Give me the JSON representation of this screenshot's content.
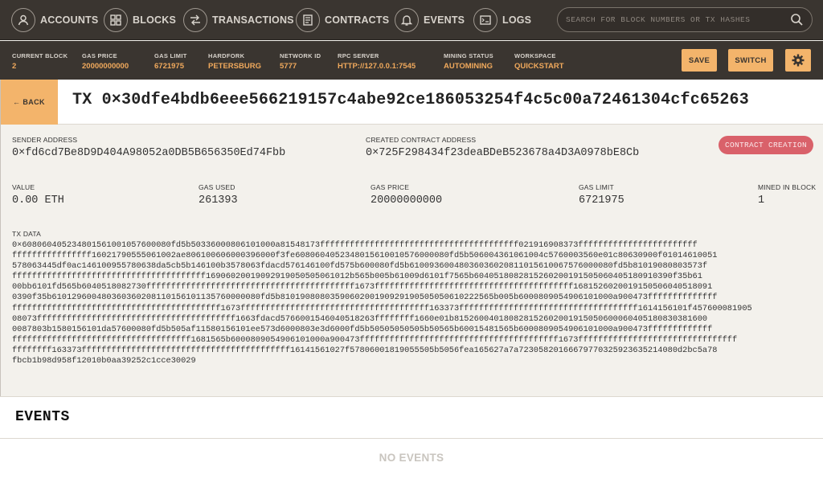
{
  "nav": {
    "items": [
      {
        "label": "ACCOUNTS",
        "icon": "accounts-icon"
      },
      {
        "label": "BLOCKS",
        "icon": "blocks-icon"
      },
      {
        "label": "TRANSACTIONS",
        "icon": "transactions-icon"
      },
      {
        "label": "CONTRACTS",
        "icon": "contracts-icon"
      },
      {
        "label": "EVENTS",
        "icon": "bell-icon"
      },
      {
        "label": "LOGS",
        "icon": "logs-icon"
      }
    ],
    "search_placeholder": "SEARCH FOR BLOCK NUMBERS OR TX HASHES"
  },
  "status": {
    "items": [
      {
        "label": "CURRENT BLOCK",
        "value": "2"
      },
      {
        "label": "GAS PRICE",
        "value": "20000000000"
      },
      {
        "label": "GAS LIMIT",
        "value": "6721975"
      },
      {
        "label": "HARDFORK",
        "value": "PETERSBURG"
      },
      {
        "label": "NETWORK ID",
        "value": "5777"
      },
      {
        "label": "RPC SERVER",
        "value": "HTTP://127.0.0.1:7545"
      },
      {
        "label": "MINING STATUS",
        "value": "AUTOMINING"
      },
      {
        "label": "WORKSPACE",
        "value": "QUICKSTART"
      }
    ],
    "save_label": "SAVE",
    "switch_label": "SWITCH"
  },
  "tx": {
    "back_label": "← BACK",
    "title": "TX 0×30dfe4bdb6eee566219157c4abe92ce186053254f4c5c00a72461304cfc65263",
    "sender_label": "SENDER ADDRESS",
    "sender": "0×fd6cd7Be8D9D404A98052a0DB5B656350Ed74Fbb",
    "created_label": "CREATED CONTRACT ADDRESS",
    "created": "0×725F298434f23deaBDeB523678a4D3A0978bE8Cb",
    "badge": "CONTRACT CREATION",
    "value_label": "VALUE",
    "value": "0.00 ETH",
    "gas_used_label": "GAS USED",
    "gas_used": "261393",
    "gas_price_label": "GAS PRICE",
    "gas_price": "20000000000",
    "gas_limit_label": "GAS LIMIT",
    "gas_limit": "6721975",
    "mined_label": "MINED IN BLOCK",
    "mined": "1",
    "data_label": "TX DATA",
    "data_lines": [
      "0×608060405234801561001057600080fd5b50336000806101000a81548173ffffffffffffffffffffffffffffffffffffffff021916908373ffffffffffffffffffffffff",
      "ffffffffffffffff16021790555061002ae806100606000396000f3fe6080604052348015610010576000080fd5b506004361061004c5760003560e01c80630900f01014610051",
      "578063445df0ac146100955780638da5cb5b146100b3578063fdacd576146100fd575b600080fd5b61009360048036036020811015610067576000080fd5b81019080803573f",
      "fffffffffffffffffffffffffffffffffffffff16906020019092919050505061012b565b005b61009d6101f7565b6040518082815260200191505060405180910390f35b61",
      "00bb6101fd565b6040518082730ffffffffffffffffffffffffffffffffffffffffff1673ffffffffffffffffffffffffffffffffffffffff1681526020019150506040518091",
      "0390f35b610129600480360360208110156101135760000080fd5b8101908080359060200190929190505050610222565b005b6000809054906101000a900473ffffffffffffff",
      "ffffffffffffffffffffffffffffffffffffffffff1673ffffffffffffffffffffffffffffffffffffff163373ffffffffffffffffffffffffffffffffffff1614156101f457600081905",
      "08073ffffffffffffffffffffffffffffffffffffffff1663fdacd5766001546040518263ffffffff1660e01b815260040180828152602001915050600060405180830381600",
      "0087803b1580156101da57600080fd5b505af11580156101ee573d6000803e3d6000fd5b50505050505b50565b60015481565b6000809054906101000a900473fffffffffffff",
      "ffffffffffffffffffffffffffffffffffff1681565b6000809054906101000a900473ffffffffffffffffffffffffffffffffffffffff1673ffffffffffffffffffffffffffffffff",
      "ffffffff163373ffffffffffffffffffffffffffffffffffffffffff16141561027f57806001819055505b5056fea165627a7a72305820166679770325923635214080d2bc5a78",
      "fbcb1b98d958f12010b0aa39252c1cce30029"
    ]
  },
  "events": {
    "title": "EVENTS",
    "empty": "NO EVENTS"
  }
}
